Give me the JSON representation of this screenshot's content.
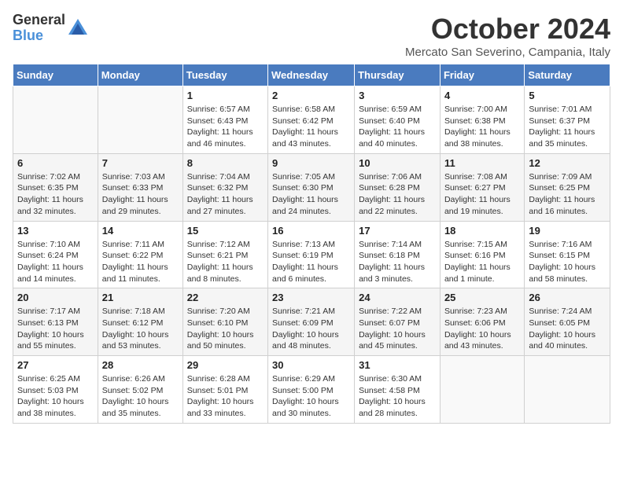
{
  "logo": {
    "general": "General",
    "blue": "Blue"
  },
  "title": "October 2024",
  "location": "Mercato San Severino, Campania, Italy",
  "days_of_week": [
    "Sunday",
    "Monday",
    "Tuesday",
    "Wednesday",
    "Thursday",
    "Friday",
    "Saturday"
  ],
  "weeks": [
    [
      {
        "day": "",
        "info": ""
      },
      {
        "day": "",
        "info": ""
      },
      {
        "day": "1",
        "info": "Sunrise: 6:57 AM\nSunset: 6:43 PM\nDaylight: 11 hours and 46 minutes."
      },
      {
        "day": "2",
        "info": "Sunrise: 6:58 AM\nSunset: 6:42 PM\nDaylight: 11 hours and 43 minutes."
      },
      {
        "day": "3",
        "info": "Sunrise: 6:59 AM\nSunset: 6:40 PM\nDaylight: 11 hours and 40 minutes."
      },
      {
        "day": "4",
        "info": "Sunrise: 7:00 AM\nSunset: 6:38 PM\nDaylight: 11 hours and 38 minutes."
      },
      {
        "day": "5",
        "info": "Sunrise: 7:01 AM\nSunset: 6:37 PM\nDaylight: 11 hours and 35 minutes."
      }
    ],
    [
      {
        "day": "6",
        "info": "Sunrise: 7:02 AM\nSunset: 6:35 PM\nDaylight: 11 hours and 32 minutes."
      },
      {
        "day": "7",
        "info": "Sunrise: 7:03 AM\nSunset: 6:33 PM\nDaylight: 11 hours and 29 minutes."
      },
      {
        "day": "8",
        "info": "Sunrise: 7:04 AM\nSunset: 6:32 PM\nDaylight: 11 hours and 27 minutes."
      },
      {
        "day": "9",
        "info": "Sunrise: 7:05 AM\nSunset: 6:30 PM\nDaylight: 11 hours and 24 minutes."
      },
      {
        "day": "10",
        "info": "Sunrise: 7:06 AM\nSunset: 6:28 PM\nDaylight: 11 hours and 22 minutes."
      },
      {
        "day": "11",
        "info": "Sunrise: 7:08 AM\nSunset: 6:27 PM\nDaylight: 11 hours and 19 minutes."
      },
      {
        "day": "12",
        "info": "Sunrise: 7:09 AM\nSunset: 6:25 PM\nDaylight: 11 hours and 16 minutes."
      }
    ],
    [
      {
        "day": "13",
        "info": "Sunrise: 7:10 AM\nSunset: 6:24 PM\nDaylight: 11 hours and 14 minutes."
      },
      {
        "day": "14",
        "info": "Sunrise: 7:11 AM\nSunset: 6:22 PM\nDaylight: 11 hours and 11 minutes."
      },
      {
        "day": "15",
        "info": "Sunrise: 7:12 AM\nSunset: 6:21 PM\nDaylight: 11 hours and 8 minutes."
      },
      {
        "day": "16",
        "info": "Sunrise: 7:13 AM\nSunset: 6:19 PM\nDaylight: 11 hours and 6 minutes."
      },
      {
        "day": "17",
        "info": "Sunrise: 7:14 AM\nSunset: 6:18 PM\nDaylight: 11 hours and 3 minutes."
      },
      {
        "day": "18",
        "info": "Sunrise: 7:15 AM\nSunset: 6:16 PM\nDaylight: 11 hours and 1 minute."
      },
      {
        "day": "19",
        "info": "Sunrise: 7:16 AM\nSunset: 6:15 PM\nDaylight: 10 hours and 58 minutes."
      }
    ],
    [
      {
        "day": "20",
        "info": "Sunrise: 7:17 AM\nSunset: 6:13 PM\nDaylight: 10 hours and 55 minutes."
      },
      {
        "day": "21",
        "info": "Sunrise: 7:18 AM\nSunset: 6:12 PM\nDaylight: 10 hours and 53 minutes."
      },
      {
        "day": "22",
        "info": "Sunrise: 7:20 AM\nSunset: 6:10 PM\nDaylight: 10 hours and 50 minutes."
      },
      {
        "day": "23",
        "info": "Sunrise: 7:21 AM\nSunset: 6:09 PM\nDaylight: 10 hours and 48 minutes."
      },
      {
        "day": "24",
        "info": "Sunrise: 7:22 AM\nSunset: 6:07 PM\nDaylight: 10 hours and 45 minutes."
      },
      {
        "day": "25",
        "info": "Sunrise: 7:23 AM\nSunset: 6:06 PM\nDaylight: 10 hours and 43 minutes."
      },
      {
        "day": "26",
        "info": "Sunrise: 7:24 AM\nSunset: 6:05 PM\nDaylight: 10 hours and 40 minutes."
      }
    ],
    [
      {
        "day": "27",
        "info": "Sunrise: 6:25 AM\nSunset: 5:03 PM\nDaylight: 10 hours and 38 minutes."
      },
      {
        "day": "28",
        "info": "Sunrise: 6:26 AM\nSunset: 5:02 PM\nDaylight: 10 hours and 35 minutes."
      },
      {
        "day": "29",
        "info": "Sunrise: 6:28 AM\nSunset: 5:01 PM\nDaylight: 10 hours and 33 minutes."
      },
      {
        "day": "30",
        "info": "Sunrise: 6:29 AM\nSunset: 5:00 PM\nDaylight: 10 hours and 30 minutes."
      },
      {
        "day": "31",
        "info": "Sunrise: 6:30 AM\nSunset: 4:58 PM\nDaylight: 10 hours and 28 minutes."
      },
      {
        "day": "",
        "info": ""
      },
      {
        "day": "",
        "info": ""
      }
    ]
  ]
}
